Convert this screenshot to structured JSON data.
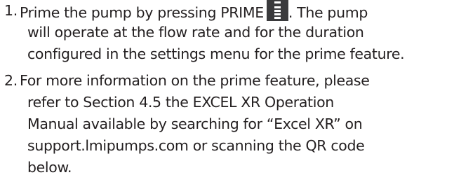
{
  "steps": [
    {
      "number": "1.",
      "lines": [
        "Prime the pump by pressing PRIME",
        ". The pump",
        "will operate at the flow rate and for the duration",
        "configured in the settings menu for the prime feature."
      ],
      "icon": "prime-button-icon"
    },
    {
      "number": "2.",
      "lines": [
        "For more information on the prime feature, please",
        "refer to Section 4.5 the EXCEL XR Operation",
        "Manual available by searching for “Excel XR” on",
        "support.lmipumps.com or scanning the QR code",
        "below."
      ]
    }
  ]
}
